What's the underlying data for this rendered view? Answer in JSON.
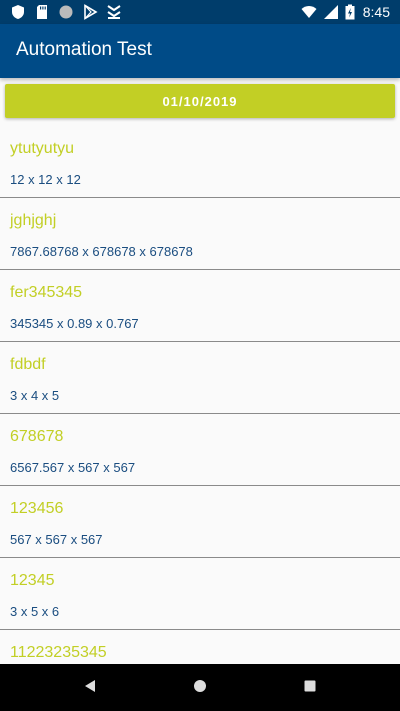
{
  "status_bar": {
    "time": "8:45",
    "left_icons": [
      "shield-icon",
      "sd-card-icon",
      "circle-icon",
      "play-store-icon",
      "download-icon"
    ],
    "right_icons": [
      "wifi-icon",
      "signal-icon",
      "battery-icon"
    ]
  },
  "app_bar": {
    "title": "Automation Test",
    "color": "#004b87"
  },
  "date_button": {
    "label": "01/10/2019",
    "color": "#c2cf25"
  },
  "items": [
    {
      "name": "ytutyutyu",
      "dims": "12 x 12 x 12"
    },
    {
      "name": "jghjghj",
      "dims": "7867.68768 x 678678 x 678678"
    },
    {
      "name": "fer345345",
      "dims": "345345 x 0.89 x 0.767"
    },
    {
      "name": "fdbdf",
      "dims": "3 x 4 x 5"
    },
    {
      "name": "678678",
      "dims": "6567.567 x 567 x 567"
    },
    {
      "name": "123456",
      "dims": "567 x 567 x 567"
    },
    {
      "name": "12345",
      "dims": "3 x 5 x 6"
    },
    {
      "name": "11223235345",
      "dims": ""
    }
  ],
  "nav_bar": {
    "buttons": [
      "back-icon",
      "home-icon",
      "recents-icon"
    ]
  }
}
